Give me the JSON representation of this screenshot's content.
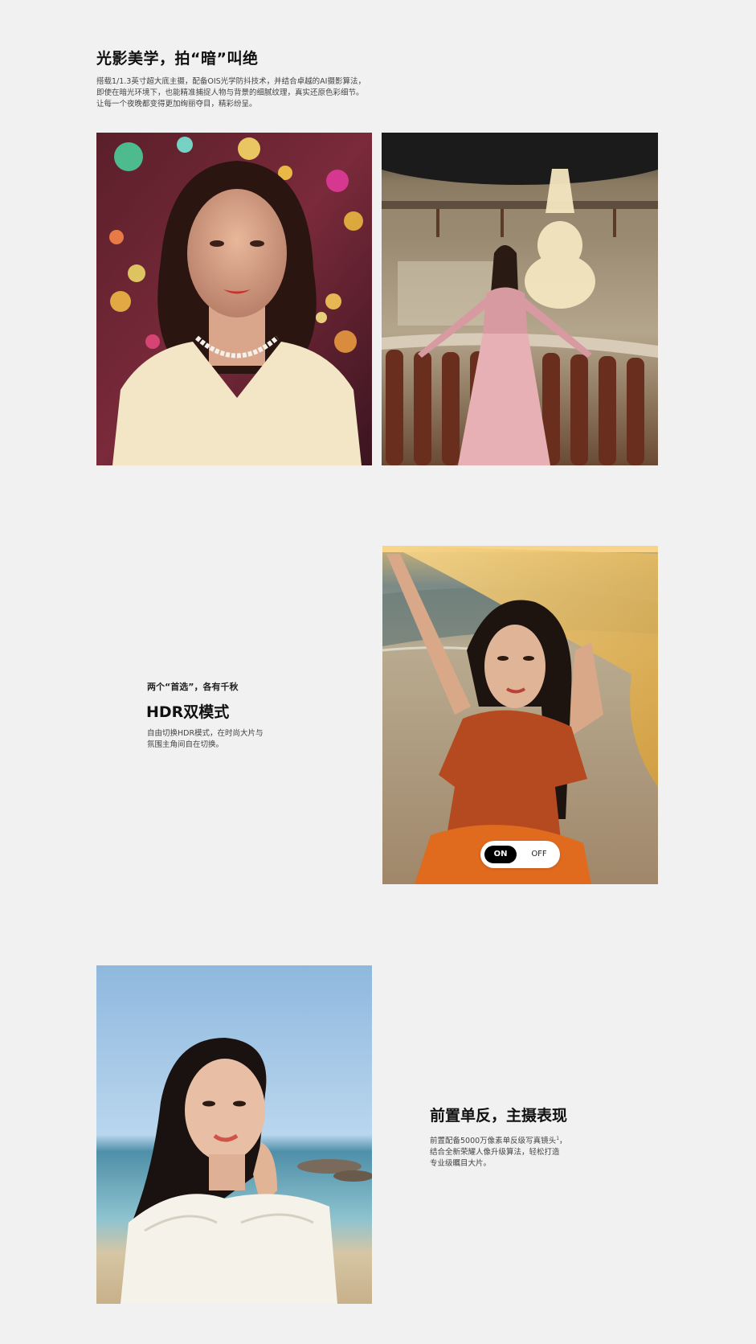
{
  "section1": {
    "title": "光影美学，拍“暗”叫绝",
    "desc_lines": [
      "搭载1/1.3英寸超大底主摄，配备OIS光学防抖技术，并结合卓越的AI摄影算法，",
      "即使在暗光环境下，也能精准捕捉人物与背景的细腻纹理，真实还原色彩细节。",
      "让每一个夜晚都变得更加绚丽夺目，精彩纷呈。"
    ]
  },
  "section2": {
    "subtitle": "两个“首选”，各有千秋",
    "title": "HDR双模式",
    "desc_lines": [
      "自由切换HDR模式，在时尚大片与",
      "氛围主角间自在切换。"
    ],
    "toggle": {
      "on_label": "ON",
      "off_label": "OFF",
      "selected": "ON"
    }
  },
  "section3": {
    "title": "前置单反，主摄表现",
    "desc_lines": [
      "前置配备5000万像素单反级写真镜头",
      "结合全新荣耀人像升级算法，轻松打造",
      "专业级瞩目大片。"
    ],
    "footnote_mark": "1",
    "line1_suffix": "，"
  }
}
